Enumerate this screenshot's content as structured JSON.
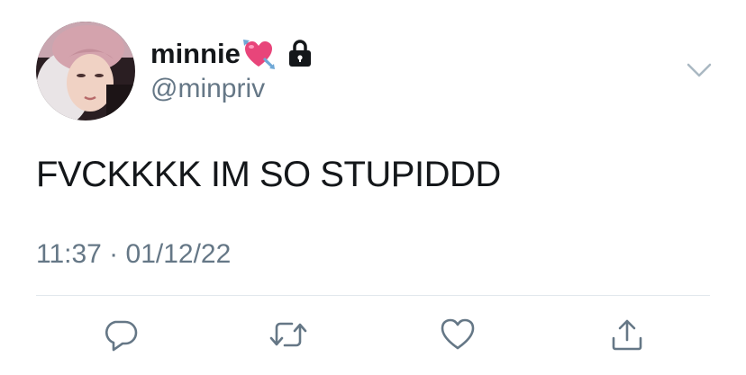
{
  "tweet": {
    "display_name": "minnie",
    "handle": "@minpriv",
    "text": "FVCKKKK IM SO STUPIDDD",
    "timestamp": "11:37 · 01/12/22",
    "badges": [
      "heart-with-arrow-icon",
      "lock-icon"
    ],
    "actions": [
      "reply-icon",
      "retweet-icon",
      "like-icon",
      "share-icon"
    ],
    "colors": {
      "text": "#14171a",
      "secondary": "#657786",
      "divider": "#e1e8ed",
      "heart": "#e8457a"
    }
  }
}
